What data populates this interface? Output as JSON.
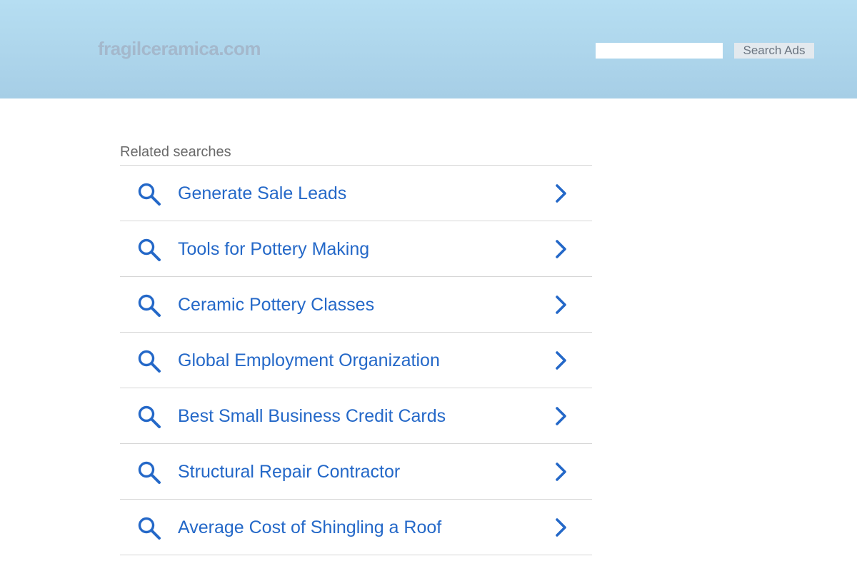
{
  "header": {
    "logo": "fragilceramica.com",
    "search_placeholder": "",
    "search_button": "Search Ads"
  },
  "related": {
    "title": "Related searches",
    "items": [
      {
        "label": "Generate Sale Leads"
      },
      {
        "label": "Tools for Pottery Making"
      },
      {
        "label": "Ceramic Pottery Classes"
      },
      {
        "label": "Global Employment Organization"
      },
      {
        "label": "Best Small Business Credit Cards"
      },
      {
        "label": "Structural Repair Contractor"
      },
      {
        "label": "Average Cost of Shingling a Roof"
      }
    ],
    "item_icon": "search-icon",
    "item_arrow_icon": "chevron-right-icon"
  },
  "colors": {
    "header_top": "#b6def2",
    "header_bottom": "#a6cee6",
    "link": "#2468c8",
    "logo": "#a4b8cc",
    "divider": "#d6d6d6"
  }
}
